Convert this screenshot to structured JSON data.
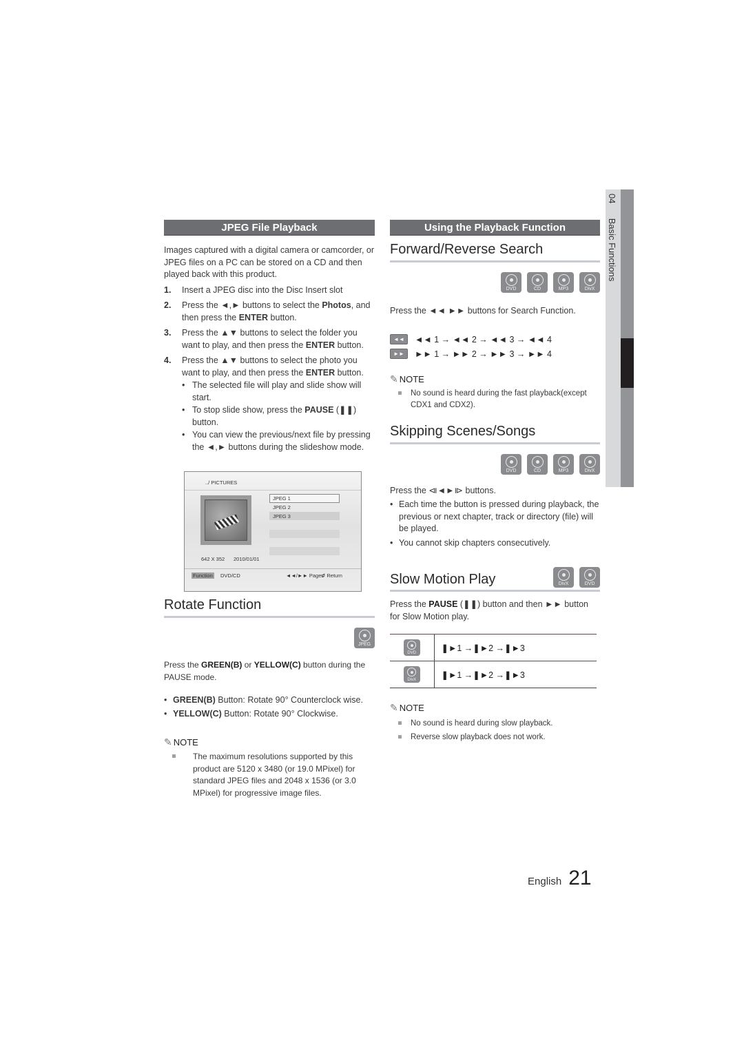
{
  "sidebar": {
    "chapter_number": "04",
    "chapter_title": "Basic Functions"
  },
  "left": {
    "section_title": "JPEG File Playback",
    "intro": "Images captured with a digital camera or camcorder, or JPEG files on a PC can be stored on a CD and then played back with this product.",
    "steps": [
      {
        "num": "1.",
        "text": "Insert a JPEG disc  into the Disc Insert slot"
      },
      {
        "num": "2.",
        "pre": "Press the ◄,► buttons to select the ",
        "bold1": "Photos",
        "mid": ", and then press the ",
        "bold2": "ENTER",
        "post": " button."
      },
      {
        "num": "3.",
        "pre": "Press the ▲▼ buttons to select the folder you want to play, and then press the ",
        "bold1": "ENTER",
        "post": " button."
      },
      {
        "num": "4.",
        "pre": "Press the ▲▼ buttons to select the photo you want to play, and then press the ",
        "bold1": "ENTER",
        "post": " button."
      }
    ],
    "step4_bullets": [
      {
        "text": "The selected file will play and slide show will start."
      },
      {
        "pre": "To stop slide show, press the ",
        "bold": "PAUSE",
        "post": " (❚❚) button."
      },
      {
        "text": "You can view the previous/next file by pressing the ◄,► buttons during the slideshow mode."
      }
    ],
    "screen": {
      "path": "../ PICTURES",
      "files": [
        "JPEG 1",
        "JPEG 2",
        "JPEG 3"
      ],
      "resolution": "642 X 352",
      "date": "2010/01/01",
      "function_label": "Function",
      "mode": "DVD/CD",
      "pages_label": "◄◄/►► Pages",
      "return_label": "↺ Return"
    },
    "rotate": {
      "title": "Rotate Function",
      "badge": "JPEG",
      "intro_pre": "Press  the ",
      "green": "GREEN(B)",
      "or": " or ",
      "yellow": "YELLOW(C)",
      "intro_post": " button during the PAUSE mode.",
      "bullets": [
        {
          "key": "GREEN(B)",
          "text": " Button: Rotate 90° Counterclock wise."
        },
        {
          "key": "YELLOW(C)",
          "text": " Button: Rotate 90° Clockwise."
        }
      ],
      "note_title": "NOTE",
      "notes": [
        "The maximum resolutions supported by this product are 5120 x 3480 (or 19.0 MPixel) for standard JPEG files and 2048 x 1536 (or 3.0 MPixel) for progressive image files."
      ]
    }
  },
  "right": {
    "section_title": "Using the Playback Function",
    "search": {
      "title": "Forward/Reverse Search",
      "badges": [
        "DVD",
        "CD",
        "MP3",
        "DivX"
      ],
      "text": "Press the ◄◄ ►► buttons for Search Function.",
      "rew_key": "◄◄",
      "ff_key": "►►",
      "rew_seq": "◄◄ 1 → ◄◄ 2 → ◄◄ 3 → ◄◄ 4",
      "ff_seq": "►► 1 → ►► 2 → ►► 3 → ►► 4",
      "note_title": "NOTE",
      "notes": [
        "No sound is heard during the fast playback(except CDX1 and CDX2)."
      ]
    },
    "skip": {
      "title": "Skipping Scenes/Songs",
      "badges": [
        "DVD",
        "CD",
        "MP3",
        "DivX"
      ],
      "text": "Press the ⧏◄►⧐ buttons.",
      "bullets": [
        "Each time the button is pressed during playback, the previous or next chapter, track or directory (file) will be played.",
        "You cannot skip chapters consecutively."
      ]
    },
    "slow": {
      "title": "Slow Motion Play",
      "badges": [
        "DivX",
        "DVD"
      ],
      "text_pre": "Press the ",
      "pause": "PAUSE",
      "text_post": " (❚❚) button and then ►► button for Slow Motion play.",
      "rows": [
        {
          "badge": "DVD",
          "seq": "❚►1 →❚►2 →❚►3"
        },
        {
          "badge": "DivX",
          "seq": "❚►1 →❚►2 →❚►3"
        }
      ],
      "note_title": "NOTE",
      "notes": [
        "No sound is heard during slow playback.",
        "Reverse slow playback does not work."
      ]
    }
  },
  "footer": {
    "language": "English",
    "page_number": "21"
  }
}
